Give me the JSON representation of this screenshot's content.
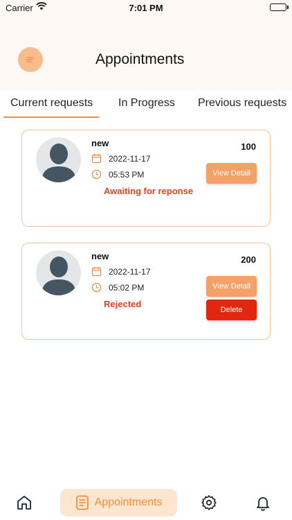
{
  "status_bar": {
    "carrier": "Carrier",
    "time": "7:01 PM"
  },
  "header": {
    "title": "Appointments"
  },
  "tabs": [
    {
      "label": "Current requests",
      "active": true
    },
    {
      "label": "In Progress",
      "active": false
    },
    {
      "label": "Previous requests",
      "active": false
    }
  ],
  "appointments": [
    {
      "name": "new",
      "date": "2022-11-17",
      "time": "05:53 PM",
      "status": "Awaiting for reponse",
      "price": "100",
      "detail_label": "View Detail"
    },
    {
      "name": "new",
      "date": "2022-11-17",
      "time": "05:02 PM",
      "status": "Rejected",
      "price": "200",
      "detail_label": "View Detail",
      "delete_label": "Delete"
    }
  ],
  "bottom_nav": {
    "home_icon": "home-icon",
    "appointments_label": "Appointments",
    "settings_icon": "gear-icon",
    "notifications_icon": "bell-icon"
  },
  "colors": {
    "accent": "#f28b3c",
    "button": "#f4a169",
    "danger": "#e3260e",
    "status": "#d9431c",
    "background": "#fdf8f3"
  }
}
